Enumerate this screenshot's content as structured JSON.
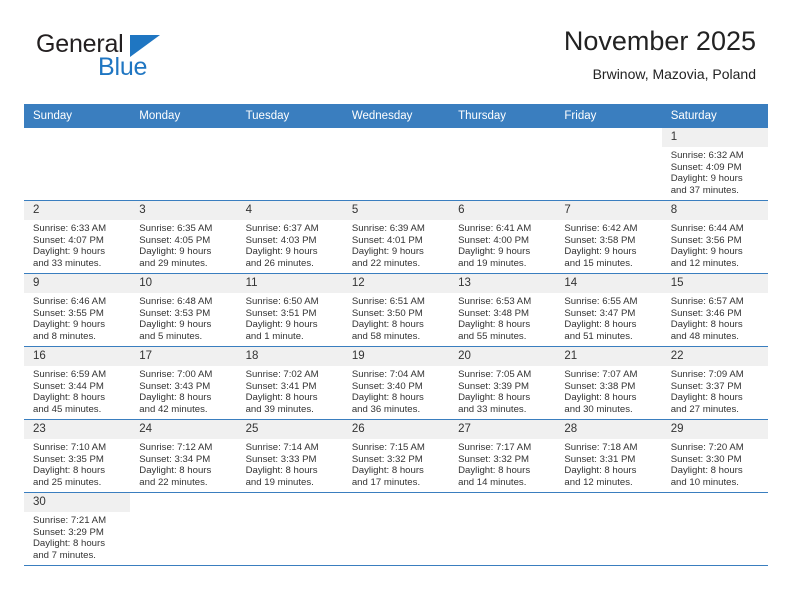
{
  "brand": {
    "name_top": "General",
    "name_bottom": "Blue",
    "accent_color": "#1f76c2"
  },
  "header": {
    "title": "November 2025",
    "subtitle": "Brwinow, Mazovia, Poland"
  },
  "calendar": {
    "header_color": "#3a7ebf",
    "daynum_bg": "#f0f0f0",
    "weekday_headers": [
      "Sunday",
      "Monday",
      "Tuesday",
      "Wednesday",
      "Thursday",
      "Friday",
      "Saturday"
    ],
    "weeks": [
      [
        {
          "blank": true
        },
        {
          "blank": true
        },
        {
          "blank": true
        },
        {
          "blank": true
        },
        {
          "blank": true
        },
        {
          "blank": true
        },
        {
          "day": "1",
          "sunrise": "Sunrise: 6:32 AM",
          "sunset": "Sunset: 4:09 PM",
          "daylight_line1": "Daylight: 9 hours",
          "daylight_line2": "and 37 minutes."
        }
      ],
      [
        {
          "day": "2",
          "sunrise": "Sunrise: 6:33 AM",
          "sunset": "Sunset: 4:07 PM",
          "daylight_line1": "Daylight: 9 hours",
          "daylight_line2": "and 33 minutes."
        },
        {
          "day": "3",
          "sunrise": "Sunrise: 6:35 AM",
          "sunset": "Sunset: 4:05 PM",
          "daylight_line1": "Daylight: 9 hours",
          "daylight_line2": "and 29 minutes."
        },
        {
          "day": "4",
          "sunrise": "Sunrise: 6:37 AM",
          "sunset": "Sunset: 4:03 PM",
          "daylight_line1": "Daylight: 9 hours",
          "daylight_line2": "and 26 minutes."
        },
        {
          "day": "5",
          "sunrise": "Sunrise: 6:39 AM",
          "sunset": "Sunset: 4:01 PM",
          "daylight_line1": "Daylight: 9 hours",
          "daylight_line2": "and 22 minutes."
        },
        {
          "day": "6",
          "sunrise": "Sunrise: 6:41 AM",
          "sunset": "Sunset: 4:00 PM",
          "daylight_line1": "Daylight: 9 hours",
          "daylight_line2": "and 19 minutes."
        },
        {
          "day": "7",
          "sunrise": "Sunrise: 6:42 AM",
          "sunset": "Sunset: 3:58 PM",
          "daylight_line1": "Daylight: 9 hours",
          "daylight_line2": "and 15 minutes."
        },
        {
          "day": "8",
          "sunrise": "Sunrise: 6:44 AM",
          "sunset": "Sunset: 3:56 PM",
          "daylight_line1": "Daylight: 9 hours",
          "daylight_line2": "and 12 minutes."
        }
      ],
      [
        {
          "day": "9",
          "sunrise": "Sunrise: 6:46 AM",
          "sunset": "Sunset: 3:55 PM",
          "daylight_line1": "Daylight: 9 hours",
          "daylight_line2": "and 8 minutes."
        },
        {
          "day": "10",
          "sunrise": "Sunrise: 6:48 AM",
          "sunset": "Sunset: 3:53 PM",
          "daylight_line1": "Daylight: 9 hours",
          "daylight_line2": "and 5 minutes."
        },
        {
          "day": "11",
          "sunrise": "Sunrise: 6:50 AM",
          "sunset": "Sunset: 3:51 PM",
          "daylight_line1": "Daylight: 9 hours",
          "daylight_line2": "and 1 minute."
        },
        {
          "day": "12",
          "sunrise": "Sunrise: 6:51 AM",
          "sunset": "Sunset: 3:50 PM",
          "daylight_line1": "Daylight: 8 hours",
          "daylight_line2": "and 58 minutes."
        },
        {
          "day": "13",
          "sunrise": "Sunrise: 6:53 AM",
          "sunset": "Sunset: 3:48 PM",
          "daylight_line1": "Daylight: 8 hours",
          "daylight_line2": "and 55 minutes."
        },
        {
          "day": "14",
          "sunrise": "Sunrise: 6:55 AM",
          "sunset": "Sunset: 3:47 PM",
          "daylight_line1": "Daylight: 8 hours",
          "daylight_line2": "and 51 minutes."
        },
        {
          "day": "15",
          "sunrise": "Sunrise: 6:57 AM",
          "sunset": "Sunset: 3:46 PM",
          "daylight_line1": "Daylight: 8 hours",
          "daylight_line2": "and 48 minutes."
        }
      ],
      [
        {
          "day": "16",
          "sunrise": "Sunrise: 6:59 AM",
          "sunset": "Sunset: 3:44 PM",
          "daylight_line1": "Daylight: 8 hours",
          "daylight_line2": "and 45 minutes."
        },
        {
          "day": "17",
          "sunrise": "Sunrise: 7:00 AM",
          "sunset": "Sunset: 3:43 PM",
          "daylight_line1": "Daylight: 8 hours",
          "daylight_line2": "and 42 minutes."
        },
        {
          "day": "18",
          "sunrise": "Sunrise: 7:02 AM",
          "sunset": "Sunset: 3:41 PM",
          "daylight_line1": "Daylight: 8 hours",
          "daylight_line2": "and 39 minutes."
        },
        {
          "day": "19",
          "sunrise": "Sunrise: 7:04 AM",
          "sunset": "Sunset: 3:40 PM",
          "daylight_line1": "Daylight: 8 hours",
          "daylight_line2": "and 36 minutes."
        },
        {
          "day": "20",
          "sunrise": "Sunrise: 7:05 AM",
          "sunset": "Sunset: 3:39 PM",
          "daylight_line1": "Daylight: 8 hours",
          "daylight_line2": "and 33 minutes."
        },
        {
          "day": "21",
          "sunrise": "Sunrise: 7:07 AM",
          "sunset": "Sunset: 3:38 PM",
          "daylight_line1": "Daylight: 8 hours",
          "daylight_line2": "and 30 minutes."
        },
        {
          "day": "22",
          "sunrise": "Sunrise: 7:09 AM",
          "sunset": "Sunset: 3:37 PM",
          "daylight_line1": "Daylight: 8 hours",
          "daylight_line2": "and 27 minutes."
        }
      ],
      [
        {
          "day": "23",
          "sunrise": "Sunrise: 7:10 AM",
          "sunset": "Sunset: 3:35 PM",
          "daylight_line1": "Daylight: 8 hours",
          "daylight_line2": "and 25 minutes."
        },
        {
          "day": "24",
          "sunrise": "Sunrise: 7:12 AM",
          "sunset": "Sunset: 3:34 PM",
          "daylight_line1": "Daylight: 8 hours",
          "daylight_line2": "and 22 minutes."
        },
        {
          "day": "25",
          "sunrise": "Sunrise: 7:14 AM",
          "sunset": "Sunset: 3:33 PM",
          "daylight_line1": "Daylight: 8 hours",
          "daylight_line2": "and 19 minutes."
        },
        {
          "day": "26",
          "sunrise": "Sunrise: 7:15 AM",
          "sunset": "Sunset: 3:32 PM",
          "daylight_line1": "Daylight: 8 hours",
          "daylight_line2": "and 17 minutes."
        },
        {
          "day": "27",
          "sunrise": "Sunrise: 7:17 AM",
          "sunset": "Sunset: 3:32 PM",
          "daylight_line1": "Daylight: 8 hours",
          "daylight_line2": "and 14 minutes."
        },
        {
          "day": "28",
          "sunrise": "Sunrise: 7:18 AM",
          "sunset": "Sunset: 3:31 PM",
          "daylight_line1": "Daylight: 8 hours",
          "daylight_line2": "and 12 minutes."
        },
        {
          "day": "29",
          "sunrise": "Sunrise: 7:20 AM",
          "sunset": "Sunset: 3:30 PM",
          "daylight_line1": "Daylight: 8 hours",
          "daylight_line2": "and 10 minutes."
        }
      ],
      [
        {
          "day": "30",
          "sunrise": "Sunrise: 7:21 AM",
          "sunset": "Sunset: 3:29 PM",
          "daylight_line1": "Daylight: 8 hours",
          "daylight_line2": "and 7 minutes."
        },
        {
          "blank": true
        },
        {
          "blank": true
        },
        {
          "blank": true
        },
        {
          "blank": true
        },
        {
          "blank": true
        },
        {
          "blank": true
        }
      ]
    ]
  }
}
